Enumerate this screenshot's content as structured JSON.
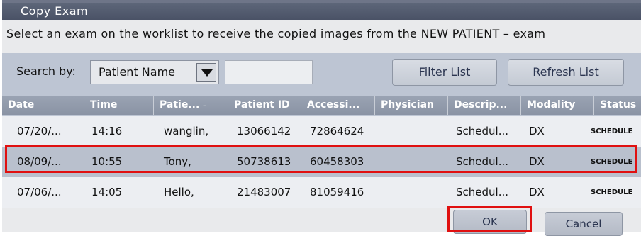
{
  "window": {
    "title": "Copy Exam"
  },
  "instruction": "Select an exam on the worklist to receive the copied images from the NEW PATIENT – exam",
  "search": {
    "label": "Search by:",
    "selected": "Patient Name",
    "input_value": ""
  },
  "buttons": {
    "filter": "Filter List",
    "refresh": "Refresh List",
    "ok": "OK",
    "cancel": "Cancel"
  },
  "table": {
    "columns": [
      "Date",
      "Time",
      "Patie...",
      "Patient ID",
      "Accessi...",
      "Physician",
      "Descrip...",
      "Modality",
      "Status"
    ],
    "sort_indicator": "–",
    "rows": [
      {
        "date": "07/20/...",
        "time": "14:16",
        "patient": "wanglin,",
        "patient_id": "13066142",
        "accession": "72864624",
        "physician": "",
        "description": "Schedul...",
        "modality": "DX",
        "status": "SCHEDULE"
      },
      {
        "date": "08/09/...",
        "time": "10:55",
        "patient": "Tony,",
        "patient_id": "50738613",
        "accession": "60458303",
        "physician": "",
        "description": "Schedul...",
        "modality": "DX",
        "status": "SCHEDULE"
      },
      {
        "date": "07/06/...",
        "time": "14:05",
        "patient": "Hello,",
        "patient_id": "21483007",
        "accession": "81059416",
        "physician": "",
        "description": "Schedul...",
        "modality": "DX",
        "status": "SCHEDULE"
      }
    ],
    "selected_row_index": 1
  },
  "colors": {
    "titlebar": "#4a5266",
    "panel": "#bdc5d3",
    "header": "#8a93a4",
    "row_default": "#e9eaee",
    "row_selected": "#b9c0cd",
    "highlight": "#e01010"
  }
}
